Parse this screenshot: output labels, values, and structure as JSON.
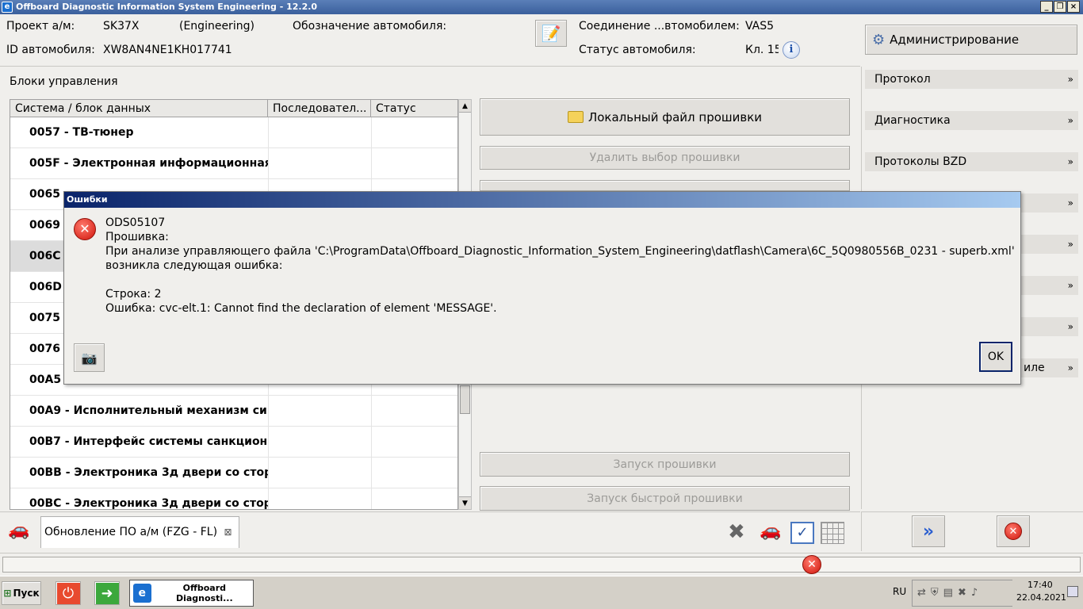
{
  "window": {
    "title": "Offboard Diagnostic Information System Engineering - 12.2.0",
    "icon": "odis-logo-icon"
  },
  "info": {
    "project_label": "Проект а/м:",
    "project_value": "SK37X",
    "project_mode": "(Engineering)",
    "designation_label": "Обозначение автомобиля:",
    "vin_label": "ID автомобиля:",
    "vin_value": "XW8AN4NE1KH017741",
    "connection_label": "Соединение ...втомобилем:",
    "connection_value": "VAS5",
    "status_label": "Статус автомобиля:",
    "status_value": "Кл. 15"
  },
  "admin_button": "Администрирование",
  "right_panel": [
    {
      "label": "Протокол"
    },
    {
      "label": "Диагностика"
    },
    {
      "label": "Протоколы BZD"
    },
    {
      "label": ""
    },
    {
      "label": ""
    },
    {
      "label": ""
    },
    {
      "label": ""
    },
    {
      "label": "иле"
    }
  ],
  "control_units": {
    "title": "Блоки управления",
    "columns": [
      "Система / блок данных",
      "Последовател...",
      "Статус"
    ],
    "rows": [
      {
        "name": "0057 - ТВ-тюнер",
        "selected": false
      },
      {
        "name": "005F - Электронная информационная",
        "selected": false
      },
      {
        "name": "0065",
        "selected": false
      },
      {
        "name": "0069",
        "selected": false
      },
      {
        "name": "006C",
        "selected": true
      },
      {
        "name": "006D",
        "selected": false
      },
      {
        "name": "0075",
        "selected": false
      },
      {
        "name": "0076",
        "selected": false
      },
      {
        "name": "00A5",
        "selected": false
      },
      {
        "name": "00A9 - Исполнительный механизм си",
        "selected": false
      },
      {
        "name": "00B7 - Интерфейс системы санкционі",
        "selected": false
      },
      {
        "name": "00BB - Электроника 3д двери со стор",
        "selected": false
      },
      {
        "name": "00BC - Электроника 3д двери со стор",
        "selected": false
      }
    ]
  },
  "flash_buttons": {
    "local_file": "Локальный файл прошивки",
    "delete_selection": "Удалить выбор прошивки",
    "start_flash": "Запуск прошивки",
    "start_fast_flash": "Запуск быстрой прошивки"
  },
  "tab": {
    "label": "Обновление ПО а/м (FZG - FL)",
    "close": "⊠"
  },
  "dialog": {
    "title": "Ошибки",
    "code": "ODS05107",
    "line1": "Прошивка:",
    "line2": "При анализе управляющего файла 'C:\\ProgramData\\Offboard_Diagnostic_Information_System_Engineering\\datflash\\Camera\\6C_5Q0980556B_0231 - superb.xml'",
    "line3": "возникла следующая ошибка:",
    "line4": "Строка:  2",
    "line5": "Ошибка: cvc-elt.1: Cannot find the declaration of element 'MESSAGE'.",
    "ok": "OK"
  },
  "taskbar": {
    "start": "Пуск",
    "active_app": "Offboard Diagnosti...",
    "lang": "RU",
    "time": "17:40",
    "date": "22.04.2021"
  },
  "colors": {
    "accent": "#0a246a",
    "error": "#d0140a"
  }
}
